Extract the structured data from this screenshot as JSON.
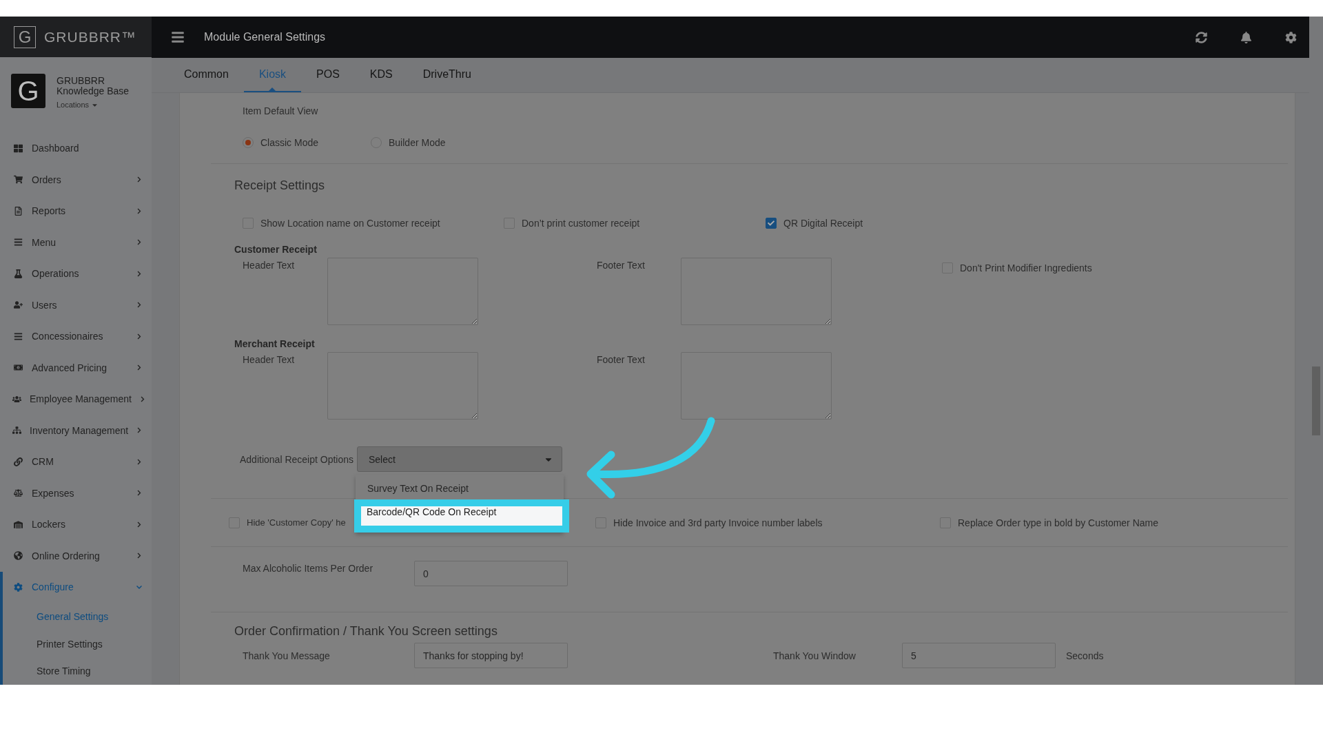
{
  "brand": {
    "name": "GRUBBRR™",
    "initial": "G"
  },
  "profile": {
    "initial": "G",
    "org_name": "GRUBBRR Knowledge Base",
    "locations": "Locations"
  },
  "sidebar": {
    "items": [
      {
        "label": "Dashboard",
        "kind": "link",
        "selected": false
      },
      {
        "label": "Orders",
        "kind": "group",
        "expanded": false,
        "selected": false
      },
      {
        "label": "Reports",
        "kind": "group",
        "expanded": false,
        "selected": false
      },
      {
        "label": "Menu",
        "kind": "group",
        "expanded": false,
        "selected": false
      },
      {
        "label": "Operations",
        "kind": "group",
        "expanded": false,
        "selected": false
      },
      {
        "label": "Users",
        "kind": "group",
        "expanded": false,
        "selected": false
      },
      {
        "label": "Concessionaires",
        "kind": "group",
        "expanded": false,
        "selected": false
      },
      {
        "label": "Advanced Pricing",
        "kind": "group",
        "expanded": false,
        "selected": false
      },
      {
        "label": "Employee Management",
        "kind": "group",
        "expanded": false,
        "selected": false
      },
      {
        "label": "Inventory Management",
        "kind": "group",
        "expanded": false,
        "selected": false
      },
      {
        "label": "CRM",
        "kind": "group",
        "expanded": false,
        "selected": false
      },
      {
        "label": "Expenses",
        "kind": "group",
        "expanded": false,
        "selected": false
      },
      {
        "label": "Lockers",
        "kind": "group",
        "expanded": false,
        "selected": false
      },
      {
        "label": "Online Ordering",
        "kind": "group",
        "expanded": false,
        "selected": false
      },
      {
        "label": "Configure",
        "kind": "group",
        "expanded": true,
        "selected": true,
        "children": [
          {
            "label": "General Settings",
            "selected": true
          },
          {
            "label": "Printer Settings",
            "selected": false
          },
          {
            "label": "Store Timing",
            "selected": false
          }
        ]
      }
    ]
  },
  "header": {
    "title": "Module General Settings"
  },
  "tabs": [
    {
      "label": "Common",
      "selected": false
    },
    {
      "label": "Kiosk",
      "selected": true
    },
    {
      "label": "POS",
      "selected": false
    },
    {
      "label": "KDS",
      "selected": false
    },
    {
      "label": "DriveThru",
      "selected": false
    }
  ],
  "item_default_view": {
    "label": "Item Default View",
    "options": [
      {
        "label": "Classic Mode",
        "selected": true
      },
      {
        "label": "Builder Mode",
        "selected": false
      }
    ]
  },
  "receipt_settings": {
    "title": "Receipt Settings",
    "options": [
      {
        "label": "Show Location name on Customer receipt",
        "checked": false
      },
      {
        "label": "Don’t print customer receipt",
        "checked": false
      },
      {
        "label": "QR Digital Receipt",
        "checked": true
      }
    ],
    "customer_receipt": {
      "title": "Customer Receipt",
      "header_label": "Header Text",
      "footer_label": "Footer Text",
      "extra_option": {
        "label": "Don't Print Modifier Ingredients",
        "checked": false
      }
    },
    "merchant_receipt": {
      "title": "Merchant Receipt",
      "header_label": "Header Text",
      "footer_label": "Footer Text"
    },
    "additional_options": {
      "label": "Additional Receipt Options",
      "value": "Select",
      "expanded": true,
      "menu": [
        {
          "label": "Survey Text On Receipt",
          "selected": false
        },
        {
          "label": "Barcode/QR Code On Receipt",
          "selected": true
        }
      ]
    },
    "more_options": [
      {
        "label": "Hide 'Customer Copy' he",
        "checked": false
      },
      {
        "label": "Hide Invoice and 3rd party Invoice number labels",
        "checked": false
      },
      {
        "label": "Replace Order type in bold by Customer Name",
        "checked": false
      }
    ],
    "max_alcoholic": {
      "label": "Max Alcoholic Items Per Order",
      "value": "0"
    }
  },
  "order_confirmation": {
    "title": "Order Confirmation / Thank You Screen settings",
    "message": {
      "label": "Thank You Message",
      "value": "Thanks for stopping by!"
    },
    "window": {
      "label": "Thank You Window",
      "value": "5",
      "unit": "Seconds"
    }
  }
}
